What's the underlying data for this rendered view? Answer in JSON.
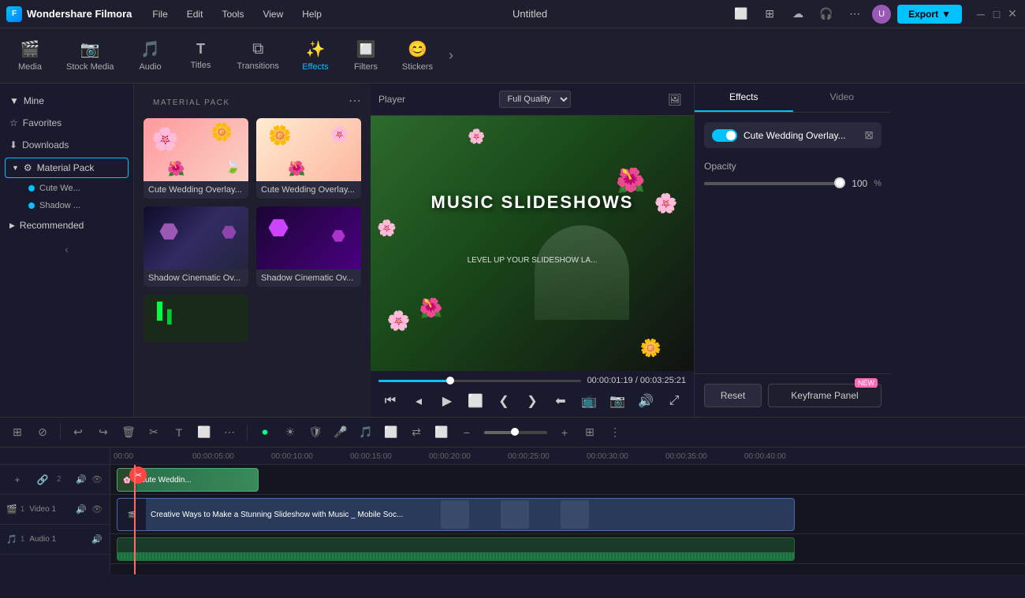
{
  "app": {
    "name": "Wondershare Filmora",
    "project": "Untitled"
  },
  "menu": {
    "items": [
      "File",
      "Edit",
      "Tools",
      "View",
      "Help"
    ]
  },
  "toolbar": {
    "items": [
      {
        "id": "media",
        "label": "Media",
        "icon": "🎬"
      },
      {
        "id": "stock-media",
        "label": "Stock Media",
        "icon": "📷"
      },
      {
        "id": "audio",
        "label": "Audio",
        "icon": "🎵"
      },
      {
        "id": "titles",
        "label": "Titles",
        "icon": "T"
      },
      {
        "id": "transitions",
        "label": "Transitions",
        "icon": "⧉"
      },
      {
        "id": "effects",
        "label": "Effects",
        "icon": "✨"
      },
      {
        "id": "filters",
        "label": "Filters",
        "icon": "🔲"
      },
      {
        "id": "stickers",
        "label": "Stickers",
        "icon": "😊"
      }
    ]
  },
  "sidebar": {
    "mine_label": "Mine",
    "favorites_label": "Favorites",
    "downloads_label": "Downloads",
    "material_pack_label": "Material Pack",
    "sub_items": [
      {
        "label": "Cute We...",
        "dot": true
      },
      {
        "label": "Shadow ...",
        "dot": true
      }
    ],
    "recommended_label": "Recommended"
  },
  "effects_panel": {
    "title": "MATERIAL PACK",
    "items": [
      {
        "label": "Cute Wedding Overlay...",
        "type": "flowers"
      },
      {
        "label": "Cute Wedding Overlay...",
        "type": "flowers2"
      },
      {
        "label": "Shadow Cinematic Ov...",
        "type": "shadow"
      },
      {
        "label": "Shadow Cinematic Ov...",
        "type": "shadow2"
      },
      {
        "label": "",
        "type": "green"
      }
    ]
  },
  "preview": {
    "label": "Player",
    "quality": "Full Quality",
    "video_text": "MUSIC SLIDESHOWS",
    "video_sub": "LEVEL UP YOUR SLIDESHOW LA...",
    "time_current": "00:00:01:19",
    "time_total": "00:03:25:21"
  },
  "properties": {
    "tabs": [
      "Effects",
      "Video"
    ],
    "active_tab": "Effects",
    "effect_name": "Cute Wedding Overlay...",
    "opacity_label": "Opacity",
    "opacity_value": "100",
    "opacity_unit": "%"
  },
  "buttons": {
    "export": "Export",
    "reset": "Reset",
    "keyframe_panel": "Keyframe Panel",
    "new_badge": "NEW"
  },
  "timeline": {
    "tracks": [
      {
        "num": "2",
        "type": "video",
        "icon": "🎬",
        "label": ""
      },
      {
        "num": "1",
        "type": "video",
        "icon": "🎬",
        "label": "Video 1"
      },
      {
        "num": "1",
        "type": "audio",
        "icon": "🎵",
        "label": "Audio 1"
      }
    ],
    "clips": {
      "overlay": "cute Weddin...",
      "main_video": "Creative Ways to Make a Stunning Slideshow with Music _ Mobile Soc..."
    },
    "ruler_marks": [
      "00:00:00",
      "00:00:05:00",
      "00:00:10:00",
      "00:00:15:00",
      "00:00:20:00",
      "00:00:25:00",
      "00:00:30:00",
      "00:00:35:00",
      "00:00:40:00"
    ]
  }
}
